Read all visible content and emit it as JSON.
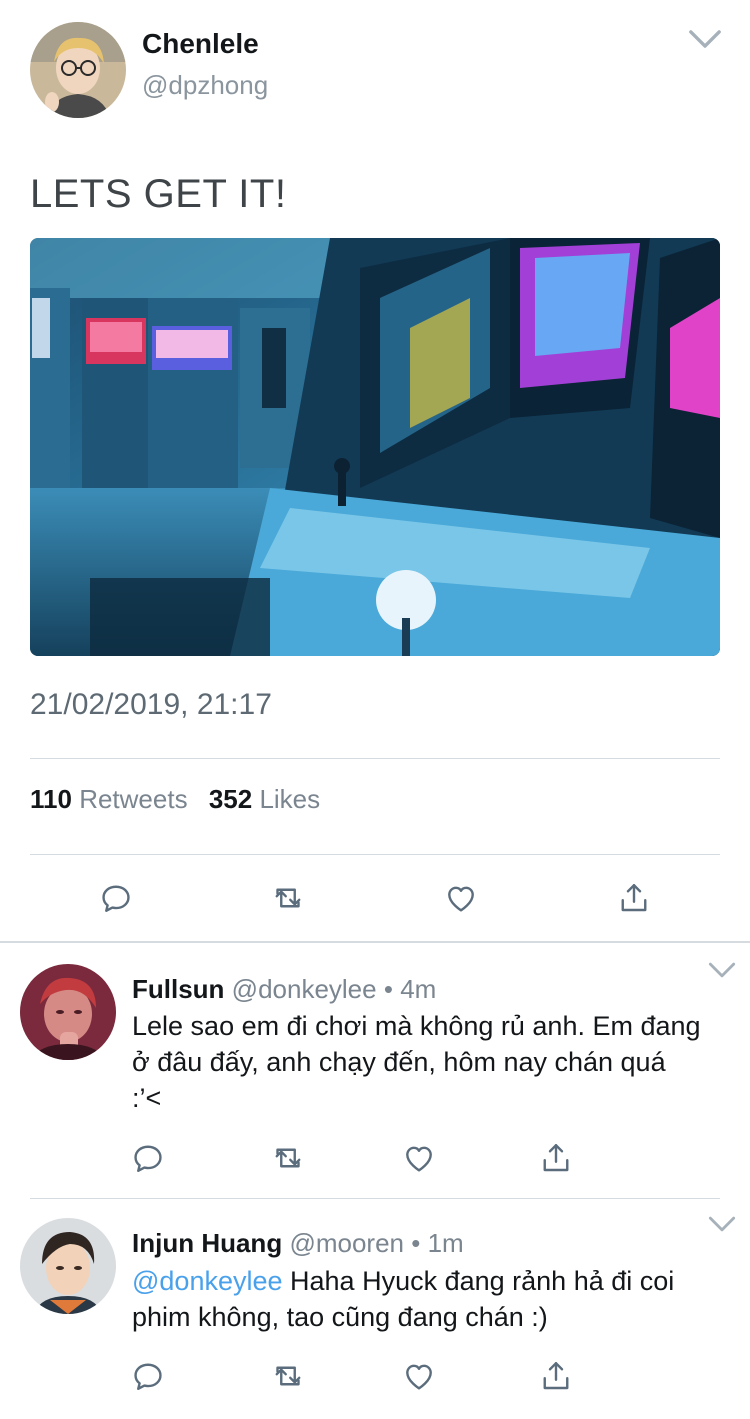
{
  "tweet": {
    "author_name": "Chenlele",
    "author_handle": "@dpzhong",
    "text": "LETS GET IT!",
    "timestamp": "21/02/2019, 21:17",
    "retweets_count": "110",
    "retweets_label": "Retweets",
    "likes_count": "352",
    "likes_label": "Likes"
  },
  "replies": [
    {
      "name": "Fullsun",
      "handle": "@donkeylee",
      "separator": "•",
      "time": "4m",
      "mention": "",
      "text": "Lele sao em đi chơi mà không rủ anh. Em đang ở đâu đấy, anh chạy đến, hôm nay chán quá :’<"
    },
    {
      "name": "Injun Huang",
      "handle": "@mooren",
      "separator": "•",
      "time": "1m",
      "mention": "@donkeylee",
      "text": "Haha Hyuck đang rảnh hả đi coi phim không, tao cũng đang chán :)"
    }
  ],
  "colors": {
    "accent": "#4aa1eb",
    "icon": "#5b6d7d",
    "divider": "#d6dbdf"
  }
}
